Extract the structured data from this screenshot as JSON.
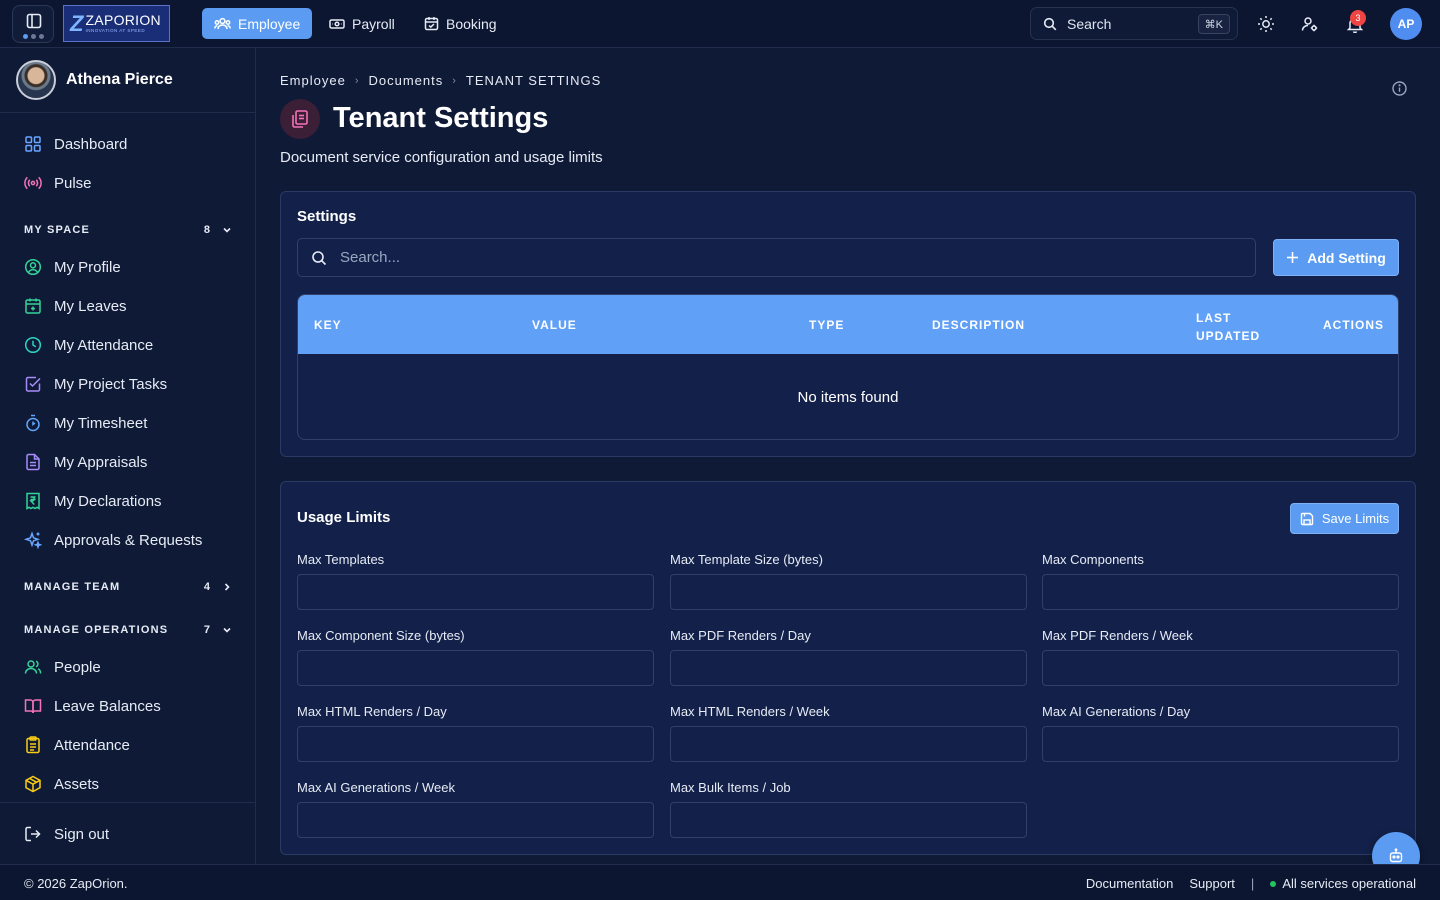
{
  "topbar": {
    "logo_text": "ZAPORION",
    "logo_tagline": "INNOVATION AT SPEED",
    "tabs": [
      {
        "label": "Employee",
        "icon": "users-icon",
        "active": true
      },
      {
        "label": "Payroll",
        "icon": "banknote-icon",
        "active": false
      },
      {
        "label": "Booking",
        "icon": "calendar-check-icon",
        "active": false
      }
    ],
    "search_label": "Search",
    "search_shortcut": "⌘K",
    "notification_count": "3",
    "avatar_initials": "AP"
  },
  "sidebar": {
    "user_name": "Athena Pierce",
    "top_items": [
      {
        "label": "Dashboard",
        "icon": "grid-icon"
      },
      {
        "label": "Pulse",
        "icon": "broadcast-icon"
      }
    ],
    "my_space": {
      "heading": "MY SPACE",
      "count": "8",
      "items": [
        {
          "label": "My Profile",
          "icon": "user-circle-icon"
        },
        {
          "label": "My Leaves",
          "icon": "calendar-plus-icon"
        },
        {
          "label": "My Attendance",
          "icon": "clock-icon"
        },
        {
          "label": "My Project Tasks",
          "icon": "checkbox-icon"
        },
        {
          "label": "My Timesheet",
          "icon": "timer-icon"
        },
        {
          "label": "My Appraisals",
          "icon": "file-text-icon"
        },
        {
          "label": "My Declarations",
          "icon": "rupee-receipt-icon"
        },
        {
          "label": "Approvals & Requests",
          "icon": "sparkle-icon"
        }
      ]
    },
    "manage_team": {
      "heading": "MANAGE TEAM",
      "count": "4"
    },
    "manage_operations": {
      "heading": "MANAGE OPERATIONS",
      "count": "7",
      "items": [
        {
          "label": "People",
          "icon": "people-icon"
        },
        {
          "label": "Leave Balances",
          "icon": "book-open-icon"
        },
        {
          "label": "Attendance",
          "icon": "clipboard-list-icon"
        },
        {
          "label": "Assets",
          "icon": "package-icon"
        }
      ]
    },
    "sign_out": "Sign out"
  },
  "main": {
    "breadcrumb": [
      "Employee",
      "Documents",
      "TENANT SETTINGS"
    ],
    "title": "Tenant Settings",
    "subtitle": "Document service configuration and usage limits",
    "settings": {
      "title": "Settings",
      "search_placeholder": "Search...",
      "add_button": "Add Setting",
      "columns": [
        "KEY",
        "VALUE",
        "TYPE",
        "DESCRIPTION",
        "LAST UPDATED",
        "ACTIONS"
      ],
      "empty_text": "No items found"
    },
    "usage_limits": {
      "title": "Usage Limits",
      "save_button": "Save Limits",
      "fields": [
        {
          "label": "Max Templates",
          "value": ""
        },
        {
          "label": "Max Template Size (bytes)",
          "value": ""
        },
        {
          "label": "Max Components",
          "value": ""
        },
        {
          "label": "Max Component Size (bytes)",
          "value": ""
        },
        {
          "label": "Max PDF Renders / Day",
          "value": ""
        },
        {
          "label": "Max PDF Renders / Week",
          "value": ""
        },
        {
          "label": "Max HTML Renders / Day",
          "value": ""
        },
        {
          "label": "Max HTML Renders / Week",
          "value": ""
        },
        {
          "label": "Max AI Generations / Day",
          "value": ""
        },
        {
          "label": "Max AI Generations / Week",
          "value": ""
        },
        {
          "label": "Max Bulk Items / Job",
          "value": ""
        }
      ]
    }
  },
  "footer": {
    "copyright": "© 2026 ZapOrion.",
    "links": [
      "Documentation",
      "Support"
    ],
    "status": "All services operational"
  },
  "colors": {
    "accent": "#5b9cf2",
    "background": "#0f1a36",
    "card": "#13214a",
    "status_ok": "#22c55e",
    "badge": "#ef4444"
  }
}
